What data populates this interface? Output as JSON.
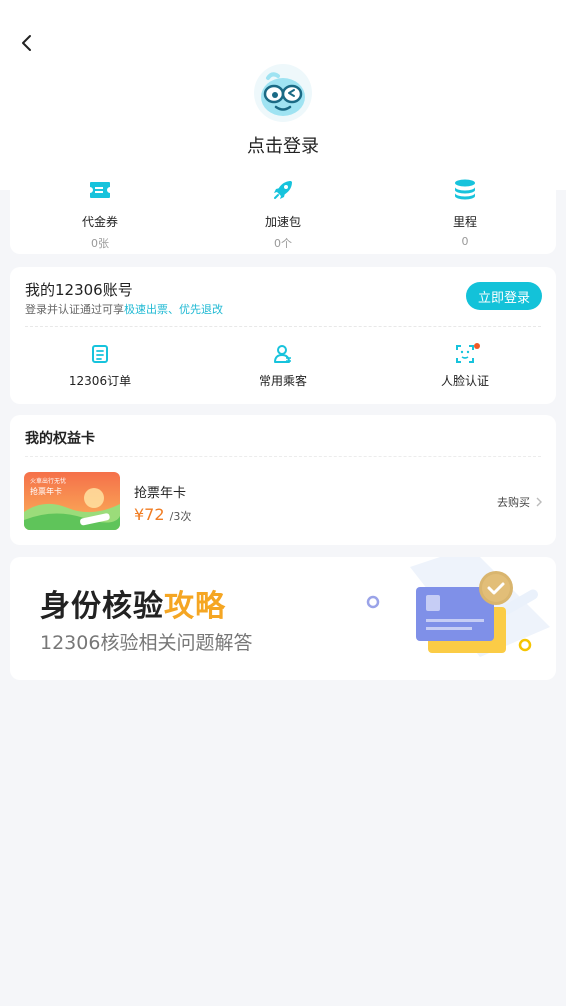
{
  "header": {
    "back_icon": "chevron-left-icon",
    "login_title": "点击登录"
  },
  "stats": [
    {
      "label": "代金券",
      "value": "0张",
      "icon": "ticket-icon"
    },
    {
      "label": "加速包",
      "value": "0个",
      "icon": "rocket-icon"
    },
    {
      "label": "里程",
      "value": "0",
      "icon": "coins-icon"
    }
  ],
  "account": {
    "title": "我的12306账号",
    "subtitle_prefix": "登录并认证通过可享",
    "subtitle_highlight": "极速出票、优先退改",
    "login_button": "立即登录",
    "quick": [
      {
        "label": "12306订单",
        "icon": "order-icon"
      },
      {
        "label": "常用乘客",
        "icon": "passenger-icon"
      },
      {
        "label": "人脸认证",
        "icon": "face-scan-icon"
      }
    ]
  },
  "rights": {
    "title": "我的权益卡",
    "card_brand": "火車出行无忧",
    "card_name": "抢票年卡",
    "product_name": "抢票年卡",
    "price": "¥72",
    "per": "/3次",
    "buy_label": "去购买"
  },
  "banner": {
    "title_main": "身份核验",
    "title_highlight": "攻略",
    "subtitle": "12306核验相关问题解答"
  },
  "colors": {
    "accent": "#13c2d9",
    "price": "#f07c22",
    "banner_highlight": "#f5a623",
    "background": "#f5f6f9"
  }
}
